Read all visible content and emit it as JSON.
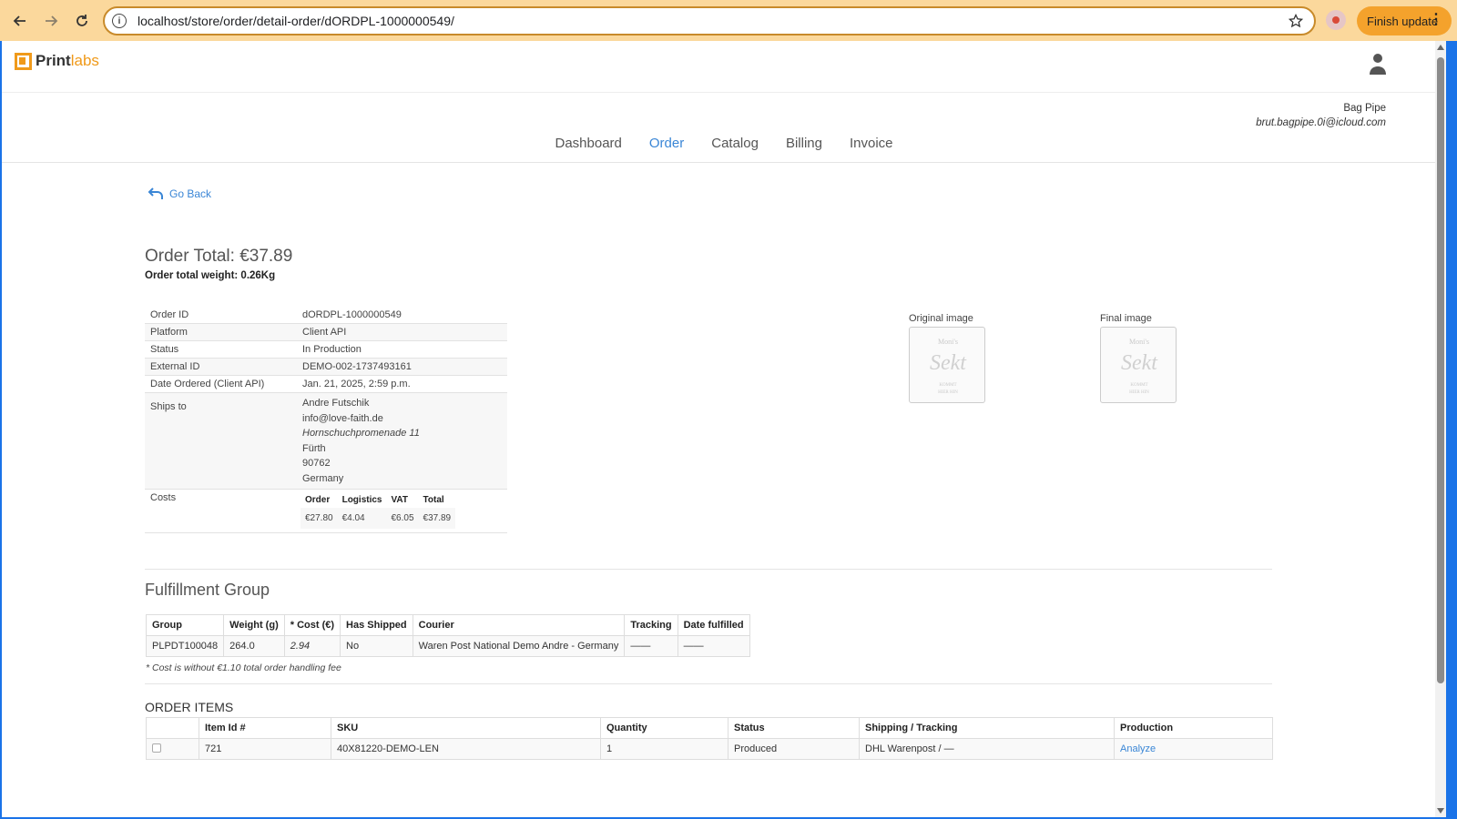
{
  "browser": {
    "url": "localhost/store/order/detail-order/dORDPL-1000000549/",
    "finish_update_label": "Finish update"
  },
  "brand": {
    "name_part1": "Print",
    "name_part2": "labs",
    "accent_color": "#f09a1a"
  },
  "account": {
    "name": "Bag Pipe",
    "email": "brut.bagpipe.0i@icloud.com"
  },
  "nav": {
    "items": [
      "Dashboard",
      "Order",
      "Catalog",
      "Billing",
      "Invoice"
    ],
    "active": "Order"
  },
  "go_back_label": "Go Back",
  "order": {
    "total_text": "Order Total: €37.89",
    "weight_text": "Order total weight: 0.26Kg",
    "details": [
      {
        "label": "Order ID",
        "value": "dORDPL-1000000549"
      },
      {
        "label": "Platform",
        "value": "Client API"
      },
      {
        "label": "Status",
        "value": "In Production"
      },
      {
        "label": "External ID",
        "value": "DEMO-002-1737493161"
      },
      {
        "label": "Date Ordered (Client API)",
        "value": "Jan. 21, 2025, 2:59 p.m."
      }
    ],
    "ships_to_label": "Ships to",
    "ships_to": {
      "name": "Andre Futschik",
      "email": "info@love-faith.de",
      "street": "Hornschuchpromenade 11",
      "city": "Fürth",
      "zip": "90762",
      "country": "Germany"
    },
    "costs_label": "Costs",
    "costs": {
      "headers": [
        "Order",
        "Logistics",
        "VAT",
        "Total"
      ],
      "values": [
        "€27.80",
        "€4.04",
        "€6.05",
        "€37.89"
      ]
    }
  },
  "images": {
    "original_label": "Original image",
    "final_label": "Final image",
    "thumb_text": {
      "top": "Moni's",
      "main": "Sekt",
      "bottom1": "KOMMT",
      "bottom2": "HIER HIN"
    }
  },
  "fulfillment": {
    "title": "Fulfillment Group",
    "headers": [
      "Group",
      "Weight (g)",
      "* Cost (€)",
      "Has Shipped",
      "Courier",
      "Tracking",
      "Date fulfilled"
    ],
    "row": [
      "PLPDT100048",
      "264.0",
      "2.94",
      "No",
      "Waren Post National Demo Andre - Germany",
      "——",
      "——"
    ],
    "note": "* Cost is without €1.10 total order handling fee"
  },
  "order_items": {
    "title": "ORDER ITEMS",
    "headers": [
      "",
      "Item Id #",
      "SKU",
      "Quantity",
      "Status",
      "Shipping / Tracking",
      "Production"
    ],
    "row": {
      "item_id": "721",
      "sku": "40X81220-DEMO-LEN",
      "quantity": "1",
      "status": "Produced",
      "shipping": "DHL Warenpost / —",
      "production_link": "Analyze"
    }
  }
}
